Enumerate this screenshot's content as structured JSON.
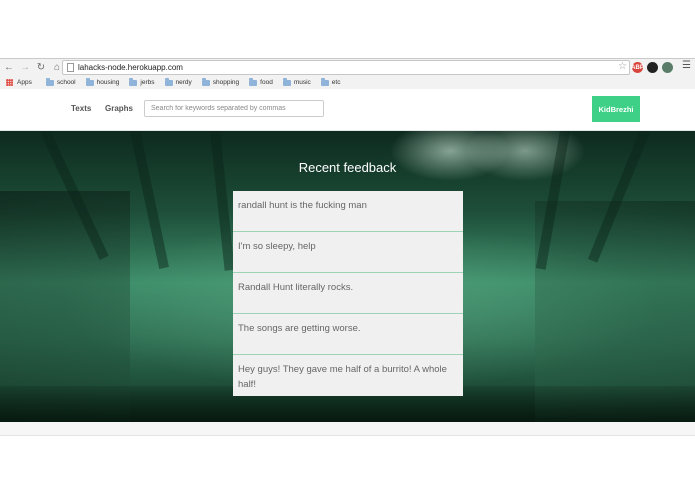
{
  "browser": {
    "url": "lahacks-node.herokuapp.com",
    "bookmarks": [
      "Apps",
      "school",
      "housing",
      "jerbs",
      "nerdy",
      "shopping",
      "food",
      "music",
      "etc"
    ],
    "extension_label": "ABP"
  },
  "site": {
    "nav": {
      "texts": "Texts",
      "graphs": "Graphs"
    },
    "search_placeholder": "Search for keywords separated by commas",
    "user_button": "KidBrezhi",
    "accent_color": "#3fd087"
  },
  "feedback": {
    "title": "Recent feedback",
    "items": [
      "randall hunt is the fucking man",
      "I'm so sleepy, help",
      "Randall Hunt literally rocks.",
      "The songs are getting worse.",
      "Hey guys! They gave me half of a burrito! A whole half!"
    ]
  },
  "icons": [
    "back-icon",
    "forward-icon",
    "reload-icon",
    "home-icon",
    "page-icon",
    "star-icon",
    "menu-icon",
    "folder-icon",
    "apps-icon"
  ]
}
